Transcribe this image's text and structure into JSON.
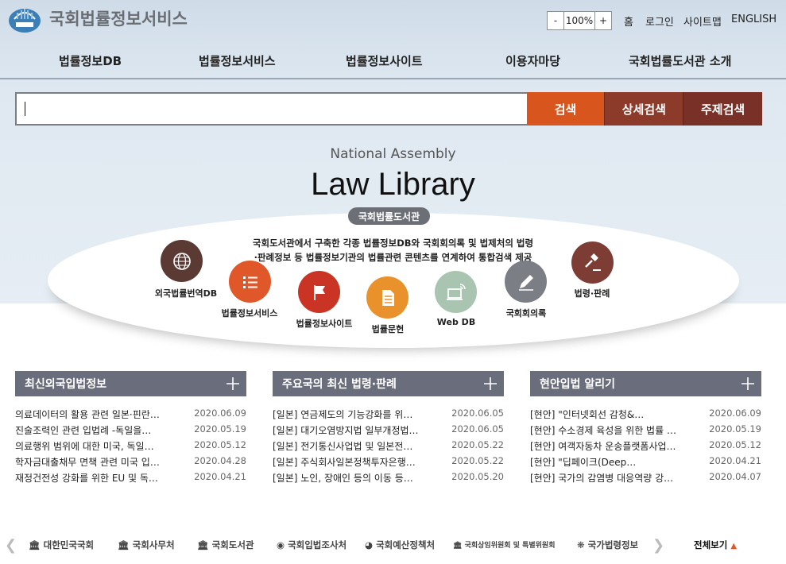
{
  "header": {
    "site_title": "국회법률정보서비스",
    "zoom_minus": "-",
    "zoom_value": "100%",
    "zoom_plus": "+",
    "util_links": [
      "홈",
      "로그인",
      "사이트맵",
      "ENGLISH"
    ]
  },
  "nav": [
    "법률정보DB",
    "법률정보서비스",
    "법률정보사이트",
    "이용자마당",
    "국회법률도서관 소개"
  ],
  "search": {
    "placeholder": "",
    "btn_search": "검색",
    "btn_detail": "상세검색",
    "btn_subject": "주제검색"
  },
  "hero": {
    "subtitle": "National Assembly",
    "title": "Law Library",
    "badge": "국회법률도서관",
    "desc_line1": "국회도서관에서 구축한 각종 법률정보DB와 국회회의록 및 법제처의 법령",
    "desc_line2": "·판례정보 등 법률정보기관의 법률관련 콘텐츠를 연계하여 통합검색 제공"
  },
  "quick_icons": [
    {
      "label": "외국법률번역DB",
      "icon": "globe-icon",
      "color": "#5a3a33"
    },
    {
      "label": "법률정보서비스",
      "icon": "list-icon",
      "color": "#e0582a"
    },
    {
      "label": "법률정보사이트",
      "icon": "flag-icon",
      "color": "#c93424"
    },
    {
      "label": "법률문헌",
      "icon": "document-icon",
      "color": "#e9912a"
    },
    {
      "label": "Web DB",
      "icon": "web-icon",
      "color": "#a9c4b0"
    },
    {
      "label": "국회회의록",
      "icon": "pen-icon",
      "color": "#7b7e85"
    },
    {
      "label": "법령·판례",
      "icon": "gavel-icon",
      "color": "#7e3d34"
    }
  ],
  "news": [
    {
      "title": "최신외국입법정보",
      "items": [
        {
          "t": "의료데이터의 활용 관련 일본·핀란…",
          "d": "2020.06.09"
        },
        {
          "t": "진술조력인 관련 입법례 -독일을…",
          "d": "2020.05.19"
        },
        {
          "t": "의료행위 범위에 대한 미국, 독일…",
          "d": "2020.05.12"
        },
        {
          "t": "학자금대출채무 면책 관련 미국 입…",
          "d": "2020.04.28"
        },
        {
          "t": "재정건전성 강화를 위한 EU 및 독…",
          "d": "2020.04.21"
        }
      ]
    },
    {
      "title": "주요국의 최신 법령·판례",
      "items": [
        {
          "t": "[일본] 연금제도의 기능강화를 위…",
          "d": "2020.06.05"
        },
        {
          "t": "[일본] 대기오염방지법 일부개정법…",
          "d": "2020.06.05"
        },
        {
          "t": "[일본] 전기통신사업법 및 일본전…",
          "d": "2020.05.22"
        },
        {
          "t": "[일본] 주식회사일본정책투자은행…",
          "d": "2020.05.22"
        },
        {
          "t": "[일본] 노인, 장애인 등의 이동 등…",
          "d": "2020.05.20"
        }
      ]
    },
    {
      "title": "현안입법 알리기",
      "items": [
        {
          "t": "[현안] \"인터넷회선 감청&…",
          "d": "2020.06.09"
        },
        {
          "t": "[현안] 수소경제 육성을 위한 법률 …",
          "d": "2020.05.19"
        },
        {
          "t": "[현안] 여객자동차 운송플랫폼사업…",
          "d": "2020.05.12"
        },
        {
          "t": "[현안] \"딥페이크(Deep…",
          "d": "2020.04.21"
        },
        {
          "t": "[현안] 국가의 감염병 대응역량 강…",
          "d": "2020.04.07"
        }
      ]
    }
  ],
  "footer": {
    "links": [
      "대한민국국회",
      "국회사무처",
      "국회도서관",
      "국회입법조사처",
      "국회예산정책처",
      "국회상임위원회 및 특별위원회",
      "국가법령정보"
    ],
    "view_all": "전체보기"
  }
}
